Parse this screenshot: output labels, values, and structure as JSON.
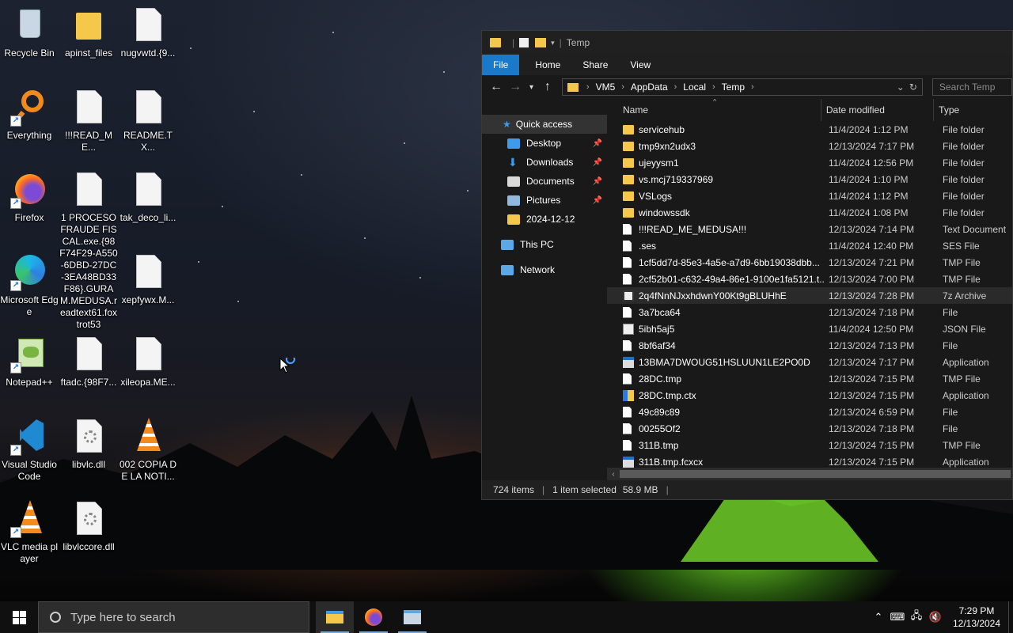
{
  "desktop": {
    "icons": [
      {
        "label": "Recycle Bin"
      },
      {
        "label": "apinst_files"
      },
      {
        "label": "nugvwtd.{9..."
      },
      {
        "label": "Everything"
      },
      {
        "label": "!!!READ_ME..."
      },
      {
        "label": "README.TX..."
      },
      {
        "label": "Firefox"
      },
      {
        "label": "1 PROCESO FRAUDE FISCAL.exe.{98F74F29-A550-6DBD-27DC-3EA48BD33F86}.GURAM.MEDUSA.readtext61.foxtrot53"
      },
      {
        "label": "tak_deco_li..."
      },
      {
        "label": "Microsoft Edge"
      },
      {
        "label": "xepfywx.M..."
      },
      {
        "label": "Notepad++"
      },
      {
        "label": "ftadc.{98F7..."
      },
      {
        "label": "xileopa.ME..."
      },
      {
        "label": "Visual Studio Code"
      },
      {
        "label": "libvlc.dll"
      },
      {
        "label": "002 COPIA DE LA NOTI..."
      },
      {
        "label": "VLC media player"
      },
      {
        "label": "libvlccore.dll"
      }
    ]
  },
  "explorer": {
    "title": "Temp",
    "ribbon_tabs": [
      "File",
      "Home",
      "Share",
      "View"
    ],
    "breadcrumb": [
      "VM5",
      "AppData",
      "Local",
      "Temp"
    ],
    "search_placeholder": "Search Temp",
    "nav": {
      "quick_access": "Quick access",
      "desktop": "Desktop",
      "downloads": "Downloads",
      "documents": "Documents",
      "pictures": "Pictures",
      "folder_2024": "2024-12-12",
      "this_pc": "This PC",
      "network": "Network"
    },
    "columns": {
      "name": "Name",
      "date": "Date modified",
      "type": "Type"
    },
    "files": [
      {
        "name": "servicehub",
        "date": "11/4/2024 1:12 PM",
        "type": "File folder",
        "icon": "folder"
      },
      {
        "name": "tmp9xn2udx3",
        "date": "12/13/2024 7:17 PM",
        "type": "File folder",
        "icon": "folder"
      },
      {
        "name": "ujeyysm1",
        "date": "11/4/2024 12:56 PM",
        "type": "File folder",
        "icon": "folder"
      },
      {
        "name": "vs.mcj719337969",
        "date": "11/4/2024 1:10 PM",
        "type": "File folder",
        "icon": "folder"
      },
      {
        "name": "VSLogs",
        "date": "11/4/2024 1:12 PM",
        "type": "File folder",
        "icon": "folder"
      },
      {
        "name": "windowssdk",
        "date": "11/4/2024 1:08 PM",
        "type": "File folder",
        "icon": "folder"
      },
      {
        "name": "!!!READ_ME_MEDUSA!!!",
        "date": "12/13/2024 7:14 PM",
        "type": "Text Document",
        "icon": "file"
      },
      {
        "name": ".ses",
        "date": "11/4/2024 12:40 PM",
        "type": "SES File",
        "icon": "file"
      },
      {
        "name": "1cf5dd7d-85e3-4a5e-a7d9-6bb19038dbb...",
        "date": "12/13/2024 7:21 PM",
        "type": "TMP File",
        "icon": "file"
      },
      {
        "name": "2cf52b01-c632-49a4-86e1-9100e1fa5121.t...",
        "date": "12/13/2024 7:00 PM",
        "type": "TMP File",
        "icon": "file"
      },
      {
        "name": "2q4fNnNJxxhdwnY00Kt9gBLUHhE",
        "date": "12/13/2024 7:28 PM",
        "type": "7z Archive",
        "icon": "archive"
      },
      {
        "name": "3a7bca64",
        "date": "12/13/2024 7:18 PM",
        "type": "File",
        "icon": "file"
      },
      {
        "name": "5ibh5aj5",
        "date": "11/4/2024 12:50 PM",
        "type": "JSON File",
        "icon": "json"
      },
      {
        "name": "8bf6af34",
        "date": "12/13/2024 7:13 PM",
        "type": "File",
        "icon": "file"
      },
      {
        "name": "13BMA7DWOUG51HSLUUN1LE2PO0D",
        "date": "12/13/2024 7:17 PM",
        "type": "Application",
        "icon": "app"
      },
      {
        "name": "28DC.tmp",
        "date": "12/13/2024 7:15 PM",
        "type": "TMP File",
        "icon": "file"
      },
      {
        "name": "28DC.tmp.ctx",
        "date": "12/13/2024 7:15 PM",
        "type": "Application",
        "icon": "ctx"
      },
      {
        "name": "49c89c89",
        "date": "12/13/2024 6:59 PM",
        "type": "File",
        "icon": "file"
      },
      {
        "name": "00255Of2",
        "date": "12/13/2024 7:18 PM",
        "type": "File",
        "icon": "file"
      },
      {
        "name": "311B.tmp",
        "date": "12/13/2024 7:15 PM",
        "type": "TMP File",
        "icon": "file"
      },
      {
        "name": "311B.tmp.fcxcx",
        "date": "12/13/2024 7:15 PM",
        "type": "Application",
        "icon": "app"
      }
    ],
    "status": {
      "items": "724 items",
      "selected": "1 item selected",
      "size": "58.9 MB"
    }
  },
  "taskbar": {
    "search_placeholder": "Type here to search",
    "time": "7:29 PM",
    "date": "12/13/2024"
  },
  "colors": {
    "accent": "#1979ca",
    "folder": "#f5c84c"
  }
}
